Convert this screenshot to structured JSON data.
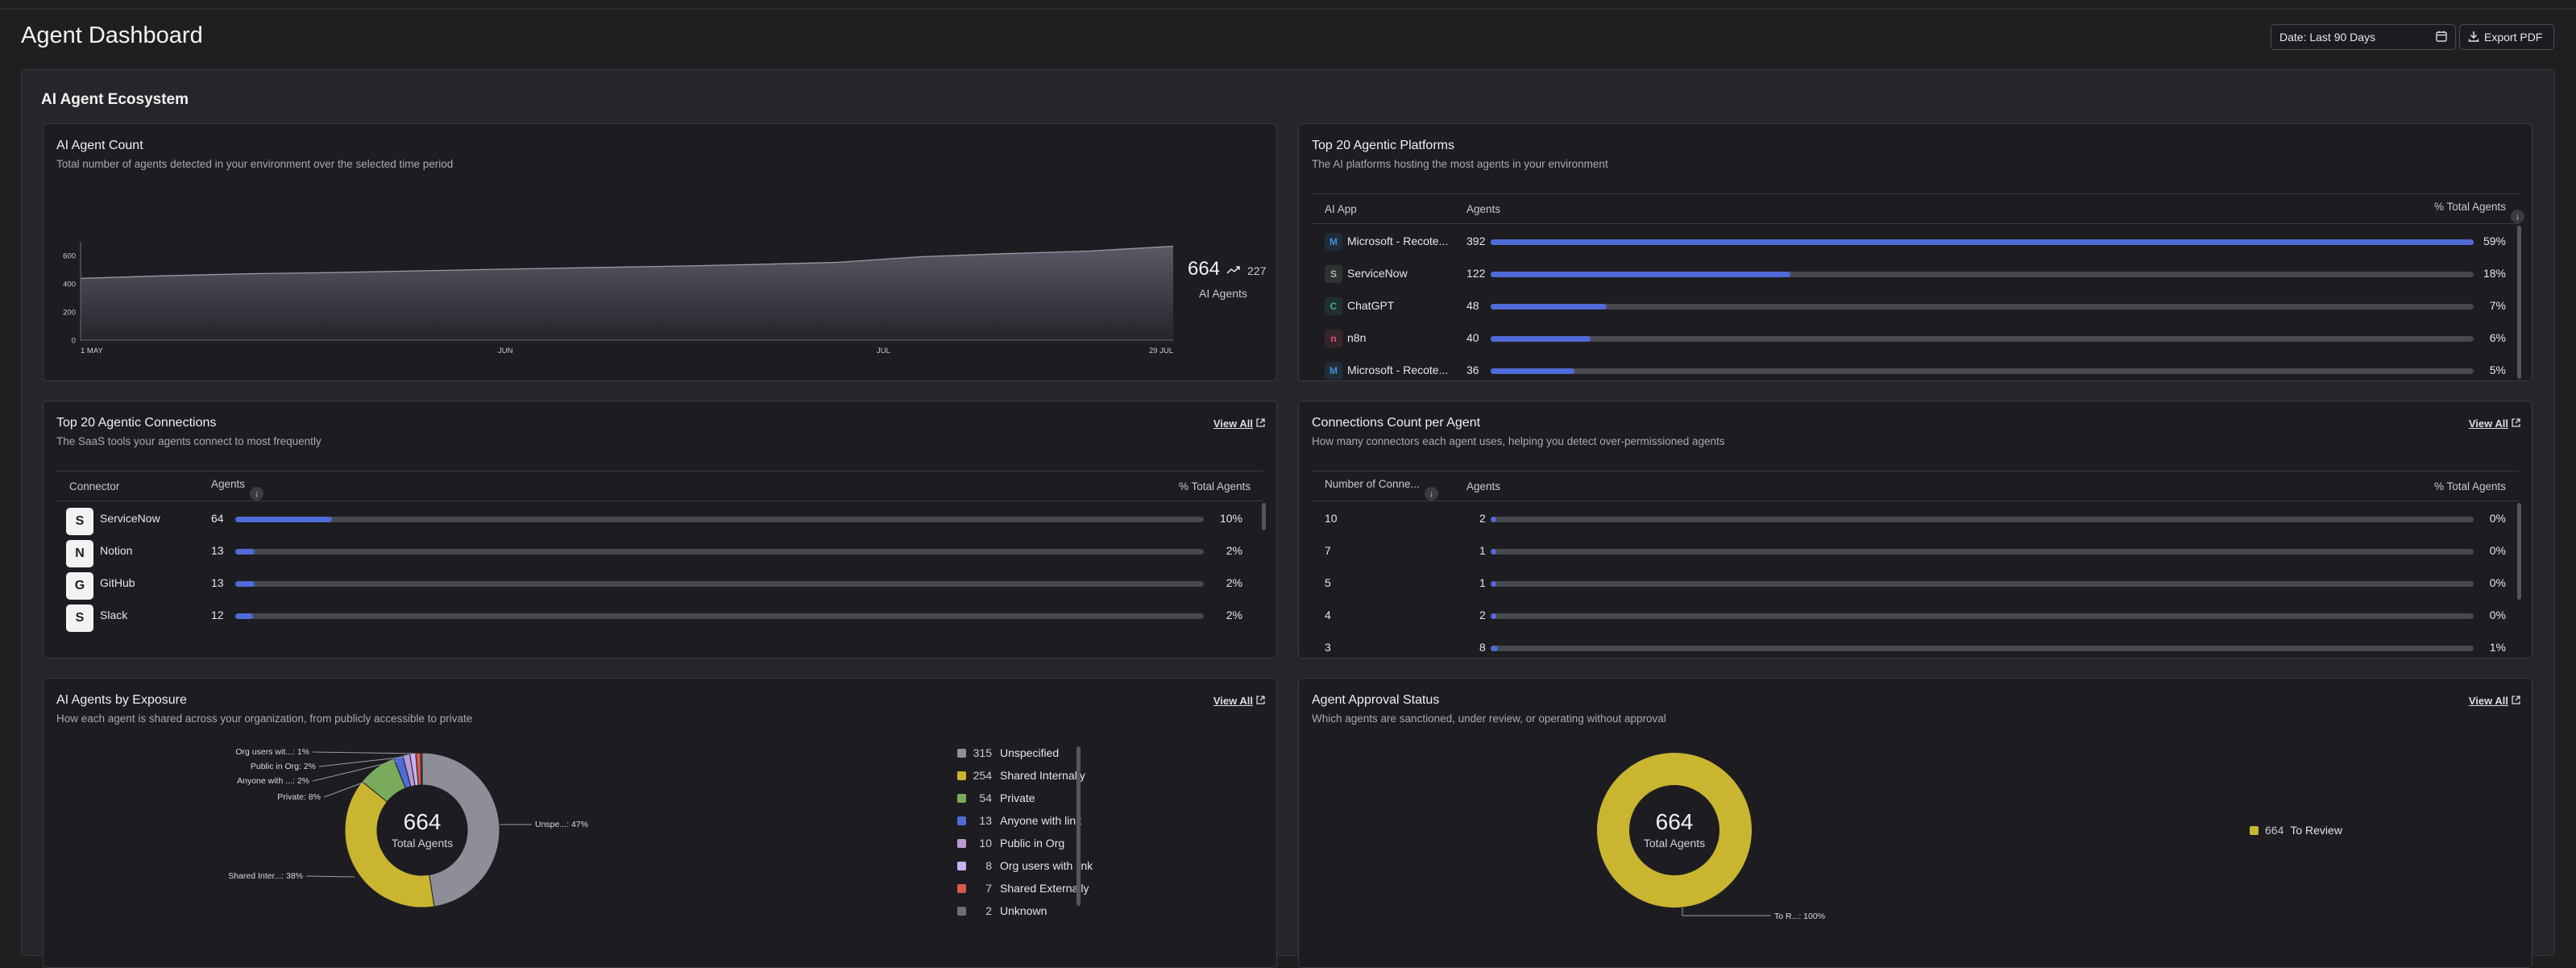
{
  "page": {
    "title": "Agent Dashboard"
  },
  "header": {
    "date_label": "Date: Last 90 Days",
    "export_label": "Export PDF"
  },
  "section": {
    "title": "AI Agent Ecosystem"
  },
  "agent_count": {
    "title": "AI Agent Count",
    "subtitle": "Total number of agents detected in your environment over the selected time period",
    "total": "664",
    "delta": "227",
    "total_label": "AI Agents",
    "chart_data": {
      "type": "area",
      "x_ticks": [
        "1 MAY",
        "JUN",
        "JUL",
        "29 JUL"
      ],
      "y_ticks": [
        "0",
        "200",
        "400",
        "600"
      ],
      "ylim": [
        0,
        650
      ],
      "x": [
        "1 MAY",
        "8 MAY",
        "15 MAY",
        "22 MAY",
        "1 JUN",
        "8 JUN",
        "15 JUN",
        "22 JUN",
        "1 JUL",
        "8 JUL",
        "11 JUL",
        "15 JUL",
        "22 JUL",
        "29 JUL"
      ],
      "values": [
        437,
        455,
        470,
        478,
        490,
        502,
        512,
        522,
        535,
        550,
        590,
        612,
        630,
        664
      ]
    }
  },
  "platforms": {
    "title": "Top 20 Agentic Platforms",
    "subtitle": "The AI platforms hosting the most agents in your environment",
    "columns": [
      "AI App",
      "Agents",
      "% Total Agents"
    ],
    "rows": [
      {
        "name": "Microsoft - Recote...",
        "agents": "392",
        "pct": "59%",
        "fill": 1.0,
        "color": "#3d8fd8",
        "icon": "microsoft-icon"
      },
      {
        "name": "ServiceNow",
        "agents": "122",
        "pct": "18%",
        "fill": 0.305,
        "color": "#9fb9ad",
        "icon": "servicenow-icon"
      },
      {
        "name": "ChatGPT",
        "agents": "48",
        "pct": "7%",
        "fill": 0.118,
        "color": "#3fae92",
        "icon": "chatgpt-icon"
      },
      {
        "name": "n8n",
        "agents": "40",
        "pct": "6%",
        "fill": 0.102,
        "color": "#e0526c",
        "icon": "n8n-icon"
      },
      {
        "name": "Microsoft - Recote...",
        "agents": "36",
        "pct": "5%",
        "fill": 0.085,
        "color": "#3d8fd8",
        "icon": "microsoft-icon"
      }
    ]
  },
  "connections": {
    "title": "Top 20 Agentic Connections",
    "subtitle": "The SaaS tools your agents connect to most frequently",
    "view_all": "View All",
    "columns": [
      "Connector",
      "Agents",
      "% Total Agents"
    ],
    "rows": [
      {
        "name": "ServiceNow",
        "agents": "64",
        "pct": "10%",
        "fill": 0.1,
        "icon": "servicenow-icon"
      },
      {
        "name": "Notion",
        "agents": "13",
        "pct": "2%",
        "fill": 0.02,
        "icon": "notion-icon"
      },
      {
        "name": "GitHub",
        "agents": "13",
        "pct": "2%",
        "fill": 0.02,
        "icon": "github-icon"
      },
      {
        "name": "Slack",
        "agents": "12",
        "pct": "2%",
        "fill": 0.018,
        "icon": "slack-icon"
      }
    ]
  },
  "conn_count": {
    "title": "Connections Count per Agent",
    "subtitle": "How many connectors each agent uses, helping you detect over-permissioned agents",
    "view_all": "View All",
    "columns": [
      "Number of Conne...",
      "Agents",
      "% Total Agents"
    ],
    "rows": [
      {
        "name": "10",
        "agents": "2",
        "pct": "0%",
        "fill": 0.0
      },
      {
        "name": "7",
        "agents": "1",
        "pct": "0%",
        "fill": 0.0
      },
      {
        "name": "5",
        "agents": "1",
        "pct": "0%",
        "fill": 0.0
      },
      {
        "name": "4",
        "agents": "2",
        "pct": "0%",
        "fill": 0.0
      },
      {
        "name": "3",
        "agents": "8",
        "pct": "1%",
        "fill": 0.007
      }
    ]
  },
  "exposure": {
    "title": "AI Agents by Exposure",
    "subtitle": "How each agent is shared across your organization, from publicly accessible to private",
    "view_all": "View All",
    "center_value": "664",
    "center_label": "Total Agents",
    "callouts": [
      "Org users wit...: 1%",
      "Public in Org: 2%",
      "Anyone with ...: 2%",
      "Private: 8%",
      "Shared Inter...: 38%",
      "Unspe...: 47%"
    ],
    "chart_data": {
      "type": "pie",
      "labels": [
        "Unspecified",
        "Shared Internally",
        "Private",
        "Anyone with link",
        "Public in Org",
        "Org users with link",
        "Shared Externally",
        "Unknown"
      ],
      "values": [
        315,
        254,
        54,
        13,
        10,
        8,
        7,
        2
      ],
      "colors": [
        "#8e8e98",
        "#c9b530",
        "#7aab5a",
        "#4f6bd8",
        "#b89ad6",
        "#c9b0f0",
        "#d95a4a",
        "#6e6e76"
      ]
    }
  },
  "approval": {
    "title": "Agent Approval Status",
    "subtitle": "Which agents are sanctioned, under review, or operating without approval",
    "view_all": "View All",
    "center_value": "664",
    "center_label": "Total Agents",
    "callout": "To R...: 100%",
    "chart_data": {
      "type": "pie",
      "labels": [
        "To Review"
      ],
      "values": [
        664
      ],
      "colors": [
        "#c9b530"
      ]
    }
  }
}
